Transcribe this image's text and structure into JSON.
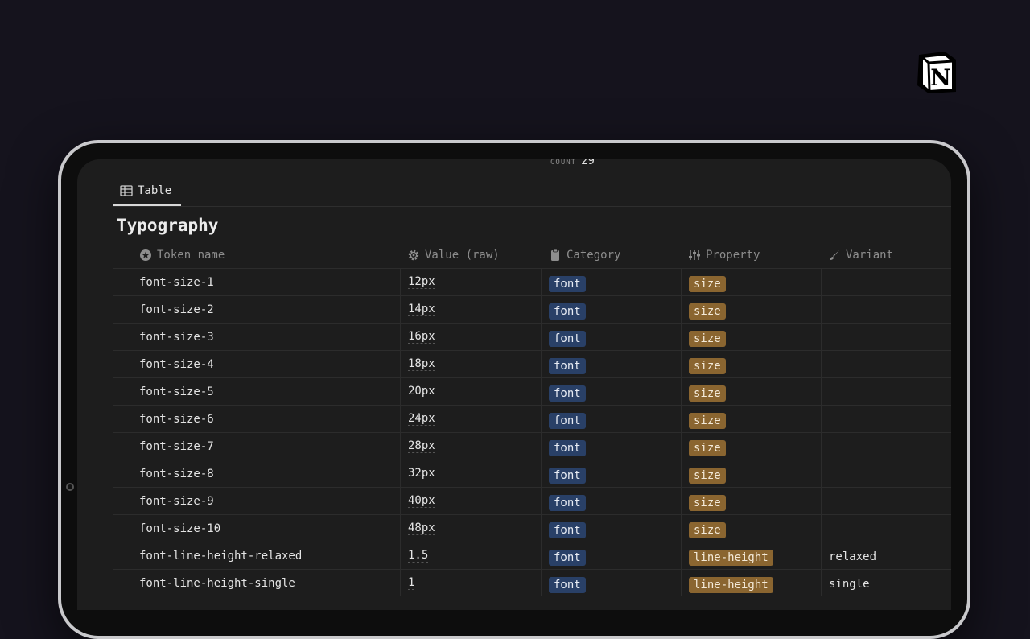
{
  "count": {
    "label": "COUNT",
    "value": "29"
  },
  "tab": {
    "label": "Table"
  },
  "title": "Typography",
  "columns": [
    {
      "label": "Token name",
      "icon": "star-circle-icon"
    },
    {
      "label": "Value (raw)",
      "icon": "gear-icon"
    },
    {
      "label": "Category",
      "icon": "clipboard-icon"
    },
    {
      "label": "Property",
      "icon": "sliders-icon"
    },
    {
      "label": "Variant",
      "icon": "brush-icon"
    }
  ],
  "rows": [
    {
      "name": "font-size-1",
      "value": "12px",
      "category": "font",
      "property": "size",
      "variant": ""
    },
    {
      "name": "font-size-2",
      "value": "14px",
      "category": "font",
      "property": "size",
      "variant": ""
    },
    {
      "name": "font-size-3",
      "value": "16px",
      "category": "font",
      "property": "size",
      "variant": ""
    },
    {
      "name": "font-size-4",
      "value": "18px",
      "category": "font",
      "property": "size",
      "variant": ""
    },
    {
      "name": "font-size-5",
      "value": "20px",
      "category": "font",
      "property": "size",
      "variant": ""
    },
    {
      "name": "font-size-6",
      "value": "24px",
      "category": "font",
      "property": "size",
      "variant": ""
    },
    {
      "name": "font-size-7",
      "value": "28px",
      "category": "font",
      "property": "size",
      "variant": ""
    },
    {
      "name": "font-size-8",
      "value": "32px",
      "category": "font",
      "property": "size",
      "variant": ""
    },
    {
      "name": "font-size-9",
      "value": "40px",
      "category": "font",
      "property": "size",
      "variant": ""
    },
    {
      "name": "font-size-10",
      "value": "48px",
      "category": "font",
      "property": "size",
      "variant": ""
    },
    {
      "name": "font-line-height-relaxed",
      "value": "1.5",
      "category": "font",
      "property": "line-height",
      "variant": "relaxed"
    },
    {
      "name": "font-line-height-single",
      "value": "1",
      "category": "font",
      "property": "line-height",
      "variant": "single"
    }
  ],
  "colors": {
    "category_tag": "#294067",
    "property_tag": "#8a6530",
    "background": "#15131d"
  }
}
